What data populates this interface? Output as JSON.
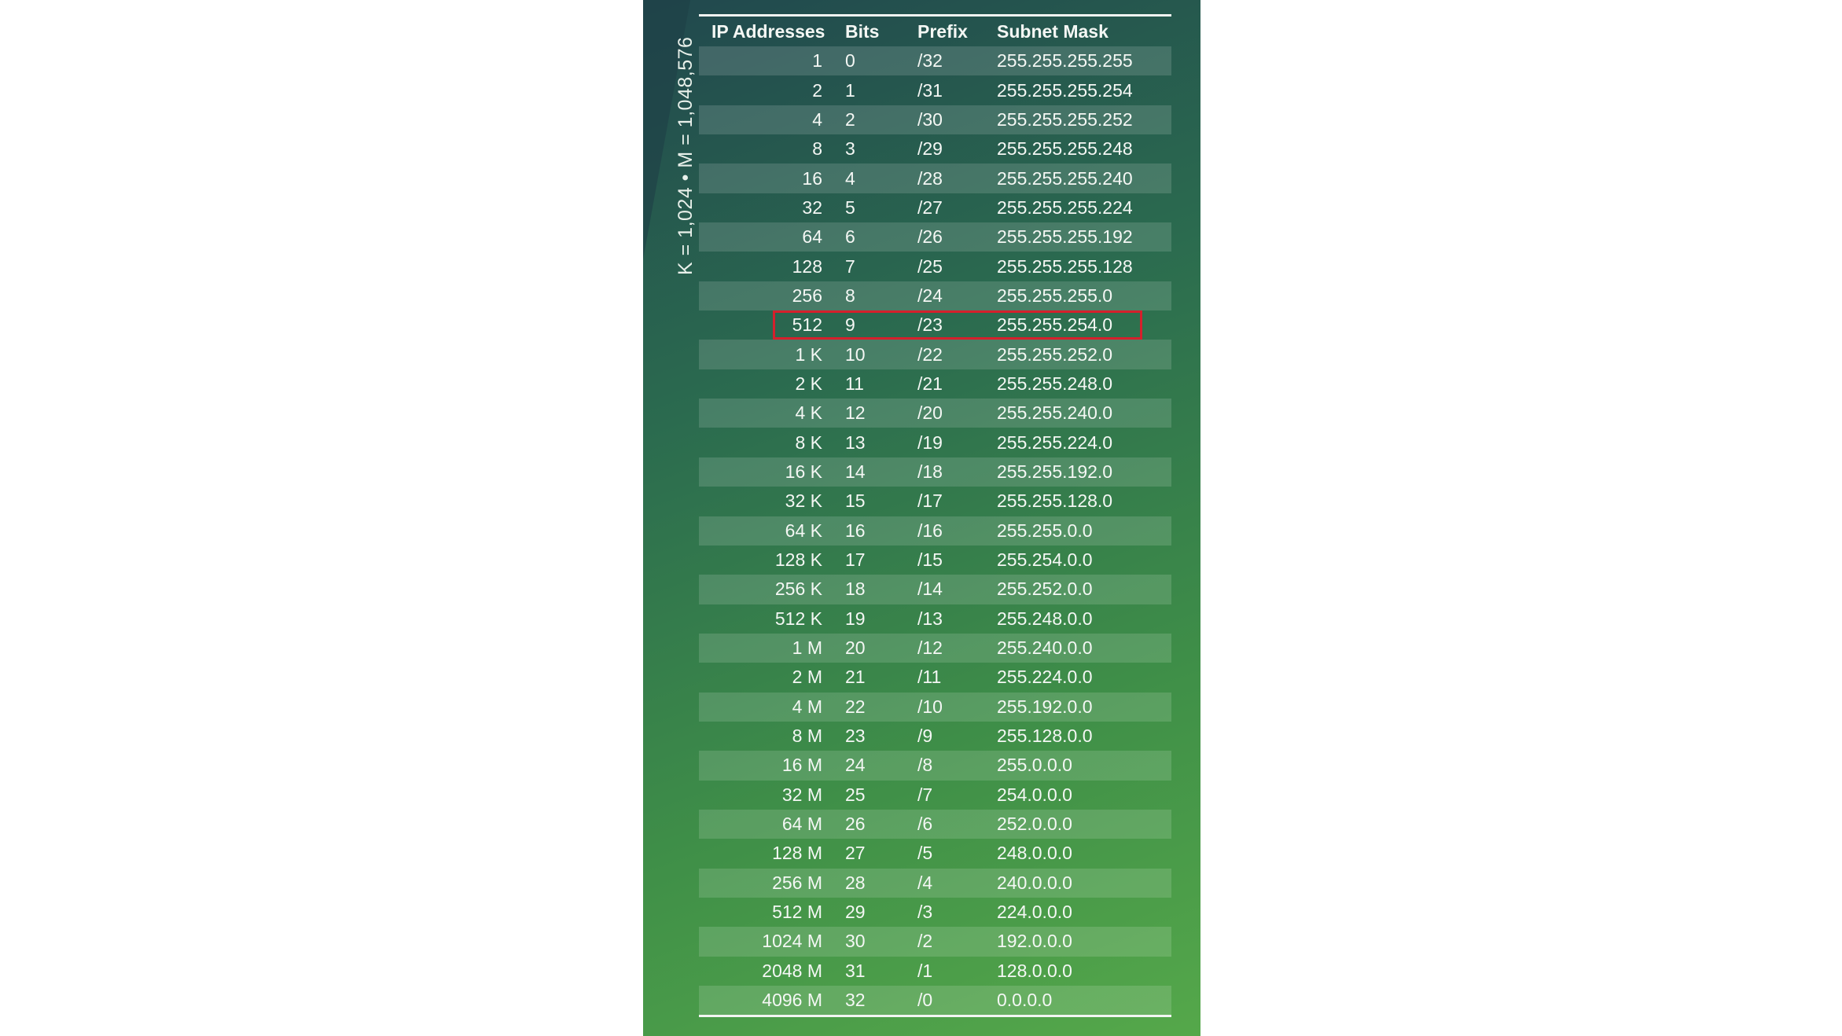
{
  "side_label": "K = 1,024 • M = 1,048,576",
  "table": {
    "headers": [
      "IP Addresses",
      "Bits",
      "Prefix",
      "Subnet Mask"
    ],
    "highlighted_row": 9,
    "rows": [
      [
        "1",
        "0",
        "/32",
        "255.255.255.255"
      ],
      [
        "2",
        "1",
        "/31",
        "255.255.255.254"
      ],
      [
        "4",
        "2",
        "/30",
        "255.255.255.252"
      ],
      [
        "8",
        "3",
        "/29",
        "255.255.255.248"
      ],
      [
        "16",
        "4",
        "/28",
        "255.255.255.240"
      ],
      [
        "32",
        "5",
        "/27",
        "255.255.255.224"
      ],
      [
        "64",
        "6",
        "/26",
        "255.255.255.192"
      ],
      [
        "128",
        "7",
        "/25",
        "255.255.255.128"
      ],
      [
        "256",
        "8",
        "/24",
        "255.255.255.0"
      ],
      [
        "512",
        "9",
        "/23",
        "255.255.254.0"
      ],
      [
        "1 K",
        "10",
        "/22",
        "255.255.252.0"
      ],
      [
        "2 K",
        "11",
        "/21",
        "255.255.248.0"
      ],
      [
        "4 K",
        "12",
        "/20",
        "255.255.240.0"
      ],
      [
        "8 K",
        "13",
        "/19",
        "255.255.224.0"
      ],
      [
        "16 K",
        "14",
        "/18",
        "255.255.192.0"
      ],
      [
        "32 K",
        "15",
        "/17",
        "255.255.128.0"
      ],
      [
        "64 K",
        "16",
        "/16",
        "255.255.0.0"
      ],
      [
        "128 K",
        "17",
        "/15",
        "255.254.0.0"
      ],
      [
        "256 K",
        "18",
        "/14",
        "255.252.0.0"
      ],
      [
        "512 K",
        "19",
        "/13",
        "255.248.0.0"
      ],
      [
        "1 M",
        "20",
        "/12",
        "255.240.0.0"
      ],
      [
        "2 M",
        "21",
        "/11",
        "255.224.0.0"
      ],
      [
        "4 M",
        "22",
        "/10",
        "255.192.0.0"
      ],
      [
        "8 M",
        "23",
        "/9",
        "255.128.0.0"
      ],
      [
        "16 M",
        "24",
        "/8",
        "255.0.0.0"
      ],
      [
        "32 M",
        "25",
        "/7",
        "254.0.0.0"
      ],
      [
        "64 M",
        "26",
        "/6",
        "252.0.0.0"
      ],
      [
        "128 M",
        "27",
        "/5",
        "248.0.0.0"
      ],
      [
        "256 M",
        "28",
        "/4",
        "240.0.0.0"
      ],
      [
        "512 M",
        "29",
        "/3",
        "224.0.0.0"
      ],
      [
        "1024 M",
        "30",
        "/2",
        "192.0.0.0"
      ],
      [
        "2048 M",
        "31",
        "/1",
        "128.0.0.0"
      ],
      [
        "4096 M",
        "32",
        "/0",
        "0.0.0.0"
      ]
    ]
  },
  "colors": {
    "highlight_border": "#d5202c",
    "text": "#f4f7f4"
  }
}
